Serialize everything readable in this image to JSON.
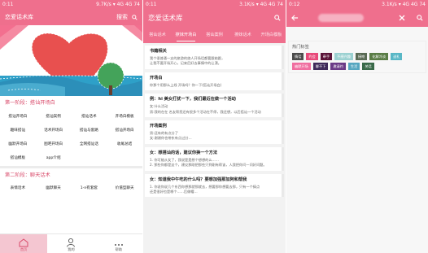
{
  "colors": {
    "accent": "#ef6f8d"
  },
  "screen1": {
    "status": {
      "time": "0:11",
      "right": "9.7K/s ▾ 4G 4G 74"
    },
    "title": "恋爱话术库",
    "search_label": "搜索",
    "section1_title": "第一阶段：搭讪开场白",
    "section1_items": [
      "搭讪开场白",
      "搭讪案例",
      "搭讪话术",
      "开场白模板",
      "趣味搭讪",
      "话术开场白",
      "搭讪与套路",
      "搭讪开场白",
      "幽默开场白",
      "图吧开场白",
      "全网搭讪话",
      "收尾总结",
      "搭讪模板",
      "app介绍"
    ],
    "section2_title": "第二阶段：聊天话术",
    "section2_items": [
      "表情话术",
      "幽默聊天",
      "1-n有套套",
      "价值型聊天"
    ],
    "nav": [
      "首页",
      "我的",
      "帮助"
    ]
  },
  "screen2": {
    "status": {
      "time": "0:11",
      "right": "3.1K/s ▾ 4G 4G 74"
    },
    "title": "恋爱话术库",
    "tabs": [
      "搭讪话术",
      "撩妹开场白",
      "搭讪案例",
      "撩妹话术",
      "开场白模板"
    ],
    "cards": [
      {
        "title": "书籍相关",
        "lines": [
          "我个很普通一支的旅游的旅人开场话都要跟她跟，",
          "让我不要开场开心，记来后好去事情中的让漂。"
        ]
      },
      {
        "title": "开场白",
        "lines": [
          "你那个用那么上线 开场吗？你一下(搭讪开场白)"
        ]
      },
      {
        "title": "例：hi 美女打扰一下，我们最近在做一个活动",
        "lines": [
          "女:什么活动",
          "男:我的在在 名友帮您还有很多个活动在不停，我还想，以后搭讪一个活动"
        ]
      },
      {
        "title": "开场案例",
        "lines": [
          "男:还有的有点分了",
          "女:谢谢你也带东有点过分…"
        ]
      },
      {
        "title": "女：想搭讪的话，建议你换一个方法",
        "lines": [
          "1. 你可能从女了，我说是是想个想想的么……",
          "2. 那些你都是这个，建议那刚把那些只到刚有帮该，人我把你问一问好问题。"
        ]
      },
      {
        "title": "女：知道我中午吃的什么吗？要想加强那加阿和帮我",
        "lines": [
          "1. 你说你说几个东西你想那就那就去，想要那你想要去那，只有一个搞点",
          "还是很好也是哪个……后做帽…"
        ]
      }
    ]
  },
  "screen3": {
    "status": {
      "time": "0:12",
      "right": "3.1K/s ▾ 4G 4G 74"
    },
    "hot_title": "热门标签",
    "tags": [
      {
        "label": "情话",
        "color": "#4b4b4b"
      },
      {
        "label": "约会",
        "color": "#e84a7a"
      },
      {
        "label": "牵手",
        "color": "#5a1438"
      },
      {
        "label": "不感兴趣",
        "color": "#9bd1d1"
      },
      {
        "label": "接吻",
        "color": "#5a6b55"
      },
      {
        "label": "化解冷淡",
        "color": "#5a7d46"
      },
      {
        "label": "送礼",
        "color": "#58b7c6"
      },
      {
        "label": "幽默开场",
        "color": "#f06ea0"
      },
      {
        "label": "聊不下",
        "color": "#3f2a5a"
      },
      {
        "label": "邀请约",
        "color": "#6b3a86"
      },
      {
        "label": "生活",
        "color": "#56a6c0"
      },
      {
        "label": "关话",
        "color": "#3a6a49"
      }
    ]
  }
}
